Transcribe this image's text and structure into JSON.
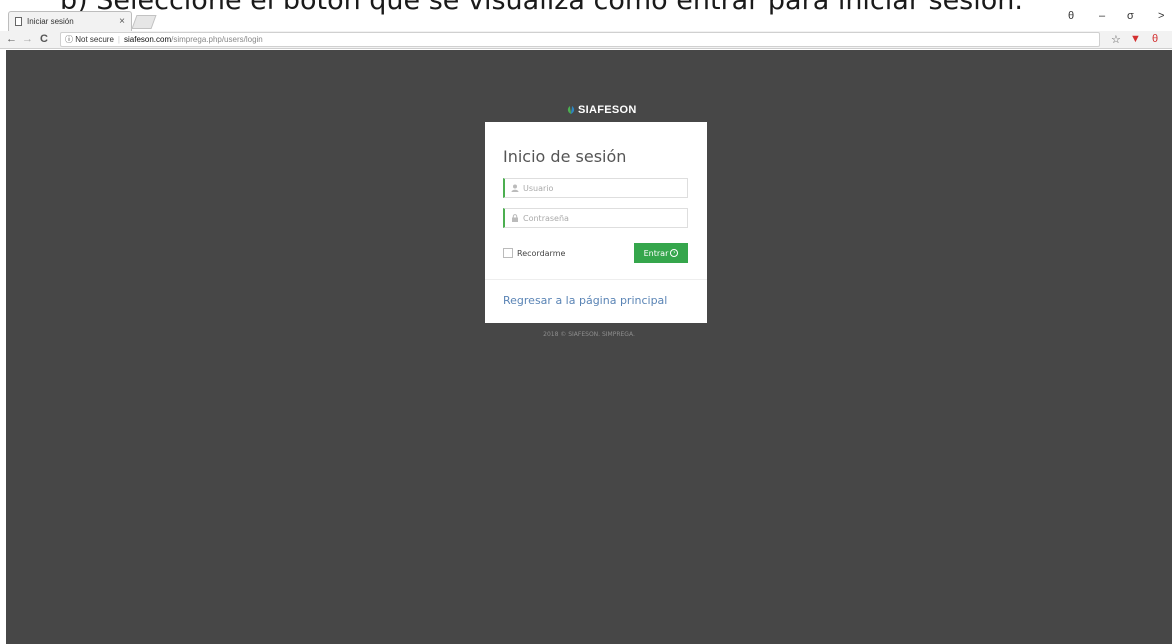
{
  "caption": "b) Seleccione el botón que se visualiza como entrar para iniciar sesión.",
  "browser": {
    "tab_title": "Iniciar sesión",
    "tab_close": "×",
    "security_label": "Not secure",
    "url_host": "siafeson.com",
    "url_path": "/simprega.php/users/login",
    "nav_back": "←",
    "nav_forward": "→",
    "nav_reload": "C",
    "info_icon": "ⓘ",
    "window_controls": {
      "profile": "θ",
      "minimize": "–",
      "restore": "σ",
      "close": ">"
    }
  },
  "page": {
    "brand": "SIAFESON",
    "card_title": "Inicio de sesión",
    "username_placeholder": "Usuario",
    "password_placeholder": "Contraseña",
    "remember_label": "Recordarme",
    "submit_label": "Entrar",
    "back_link": "Regresar a la página principal",
    "footer": "2018 © SIAFESON. SIMPREGA."
  },
  "colors": {
    "background": "#474747",
    "accent_green": "#35a64c",
    "link_blue": "#5a84b5"
  }
}
